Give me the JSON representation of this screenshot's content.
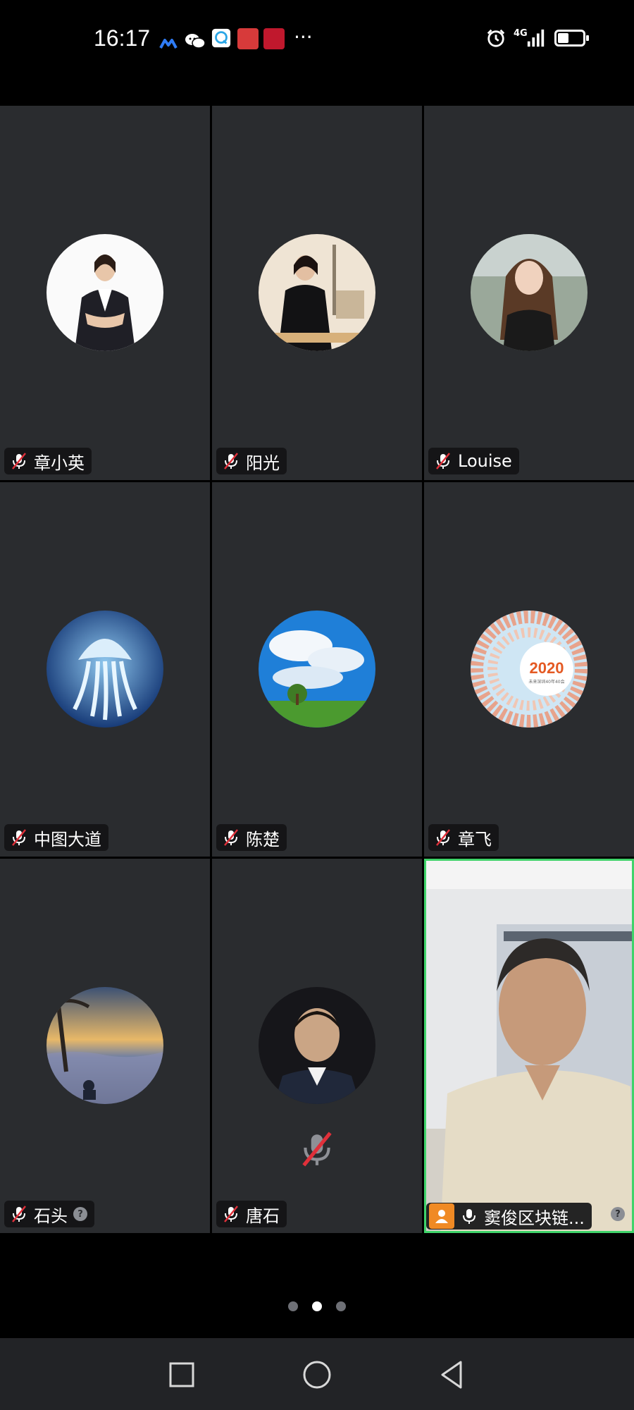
{
  "status_bar": {
    "time": "16:17",
    "left_icons": [
      "app-logo-icon",
      "wechat-icon",
      "chat-bubble-icon",
      "red-app-icon",
      "red-app-icon-2"
    ],
    "more": "···",
    "network": "4G",
    "right_icons": [
      "alarm-icon",
      "signal-icon",
      "battery-icon"
    ],
    "battery_level": 0.45
  },
  "participants": [
    {
      "name": "章小英",
      "muted": true,
      "avatar": "photo-woman-suit"
    },
    {
      "name": "阳光",
      "muted": true,
      "avatar": "photo-woman-black"
    },
    {
      "name": "Louise",
      "muted": true,
      "avatar": "photo-woman-long-hair"
    },
    {
      "name": "中图大道",
      "muted": true,
      "avatar": "jellyfish-image"
    },
    {
      "name": "陈楚",
      "muted": true,
      "avatar": "sky-tree-image"
    },
    {
      "name": "章飞",
      "muted": true,
      "avatar": "calendar-2020-image"
    },
    {
      "name": "石头",
      "muted": true,
      "avatar": "sunset-sea-image",
      "badge": "?"
    },
    {
      "name": "唐石",
      "muted": true,
      "avatar": "photo-man-suit",
      "speaking_indicator": "muted-mic"
    },
    {
      "name": "窦俊区块链...",
      "muted": false,
      "host": true,
      "video_on": true,
      "badge": "?",
      "active_speaker": true
    }
  ],
  "calendar_text": {
    "year": "2020",
    "sub": "未来深圳40年40会"
  },
  "pagination": {
    "pages": 3,
    "current": 2
  },
  "nav": {
    "recent": "recent-apps-button",
    "home": "home-button",
    "back": "back-button"
  },
  "colors": {
    "tile_bg": "#2a2c2f",
    "active_border": "#3fd36a",
    "host_badge": "#f08a24",
    "mute_red": "#e0303a"
  }
}
